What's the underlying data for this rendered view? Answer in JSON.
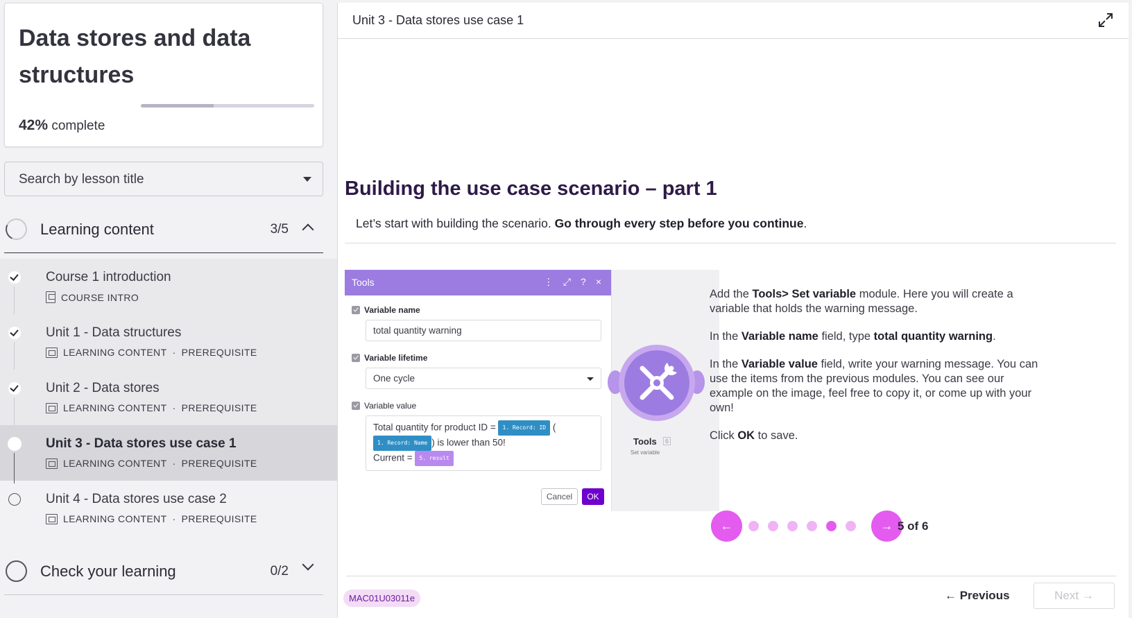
{
  "course": {
    "title": "Data stores and data structures",
    "progress_percent": "42%",
    "progress_suffix": "complete",
    "progress_fraction": 0.42
  },
  "search": {
    "label": "Search by lesson title"
  },
  "sections": [
    {
      "title": "Learning content",
      "count": "3/5"
    },
    {
      "title": "Check your learning",
      "count": "0/2"
    }
  ],
  "lessons": [
    {
      "title": "Course 1 introduction",
      "type": "COURSE INTRO",
      "tag": "",
      "status": "done",
      "icon": "document-icon"
    },
    {
      "title": "Unit 1 - Data structures",
      "type": "LEARNING CONTENT",
      "tag": "PREREQUISITE",
      "status": "done",
      "icon": "media-icon"
    },
    {
      "title": "Unit 2 - Data stores",
      "type": "LEARNING CONTENT",
      "tag": "PREREQUISITE",
      "status": "done",
      "icon": "media-icon"
    },
    {
      "title": "Unit 3 - Data stores use case 1",
      "type": "LEARNING CONTENT",
      "tag": "PREREQUISITE",
      "status": "active",
      "icon": "media-icon"
    },
    {
      "title": "Unit 4 - Data stores use case 2",
      "type": "LEARNING CONTENT",
      "tag": "PREREQUISITE",
      "status": "todo",
      "icon": "media-icon"
    }
  ],
  "meta_separator": "·",
  "main": {
    "header_title": "Unit 3 - Data stores use case 1",
    "heading": "Building the use case scenario – part 1",
    "intro_plain": "Let’s start with building the scenario. ",
    "intro_bold": "Go through every step before you continue",
    "intro_end": "."
  },
  "module": {
    "panel_title": "Tools",
    "panel_icons": [
      "⋮",
      "⤢",
      "?",
      "×"
    ],
    "var_name_label": "Variable name",
    "var_name_value": "total quantity warning",
    "var_lifetime_label": "Variable lifetime",
    "var_lifetime_value": "One cycle",
    "var_value_label": "Variable value",
    "value_text_1": "Total quantity for product ID = ",
    "pill_1": "1. Record: ID",
    "value_text_2": " (",
    "pill_2": "1. Record: Name",
    "value_text_3": ") is lower than 50!",
    "value_text_4": "Current = ",
    "pill_3": "5. result",
    "cancel": "Cancel",
    "ok": "OK",
    "tools_name": "Tools",
    "tools_badge": "6",
    "tools_sub": "Set variable"
  },
  "description": {
    "p1_a": "Add the ",
    "p1_b": "Tools> Set variable",
    "p1_c": " module. Here you will create a variable that holds the warning message.",
    "p2_a": "In the ",
    "p2_b": "Variable name",
    "p2_c": " field, type ",
    "p2_d": "total quantity warning",
    "p2_e": ".",
    "p3_a": "In the ",
    "p3_b": "Variable value",
    "p3_c": " field, write your warning message. You can use the items from the previous modules. You can see our example on the image, feel free to copy it, or come up with your own!",
    "p4_a": "Click ",
    "p4_b": "OK",
    "p4_c": " to save."
  },
  "carousel": {
    "prev": "←",
    "next": "→",
    "count_label": "5 of 6",
    "current": 5,
    "total": 6
  },
  "footer": {
    "code": "MAC01U03011e",
    "previous": "← Previous",
    "next": "Next →"
  },
  "colors": {
    "accent": "#e45bf0",
    "accent_light": "#efb3f6",
    "heading": "#2e1a47",
    "module_purple": "#9c7ce0",
    "ok_button": "#6d00cc"
  }
}
